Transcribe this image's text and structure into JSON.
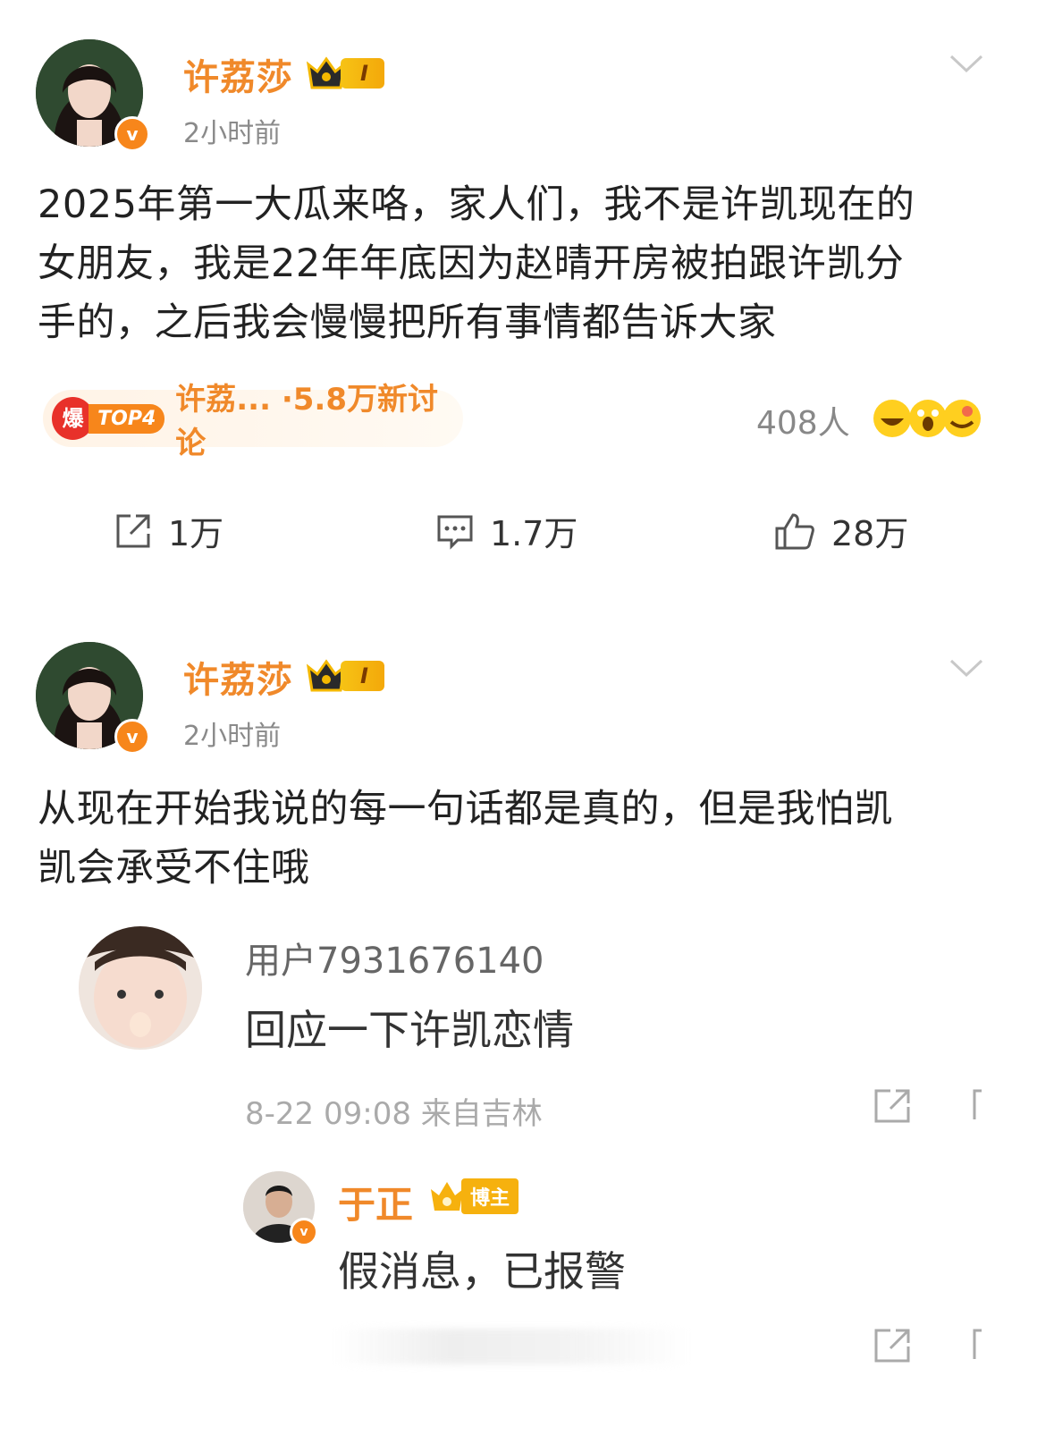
{
  "posts": [
    {
      "username": "许荔莎",
      "level": "I",
      "time": "2小时前",
      "text_lines": [
        "2025年第一大瓜来咯，家人们，我不是许凯现在的",
        "女朋友，我是22年年底因为赵晴开房被拍跟许凯分",
        "手的，之后我会慢慢把所有事情都告诉大家"
      ],
      "hot_tag": {
        "icon_label": "爆",
        "rank": "TOP4",
        "text": "许荔... ·5.8万新讨论"
      },
      "reactions": {
        "count": "408人"
      },
      "actions": {
        "share": "1万",
        "comment": "1.7万",
        "like": "28万"
      }
    },
    {
      "username": "许荔莎",
      "level": "I",
      "time": "2小时前",
      "text_lines": [
        "从现在开始我说的每一句话都是真的，但是我怕凯",
        "凯会承受不住哦"
      ]
    }
  ],
  "comment": {
    "username": "用户7931676140",
    "text": "回应一下许凯恋情",
    "meta": "8-22 09:08 来自吉林"
  },
  "reply": {
    "username": "于正",
    "badge": "博主",
    "text": "假消息，已报警"
  },
  "colors": {
    "accent": "#f0892a",
    "hot": "#e8312a",
    "muted": "#8a8a8a"
  }
}
